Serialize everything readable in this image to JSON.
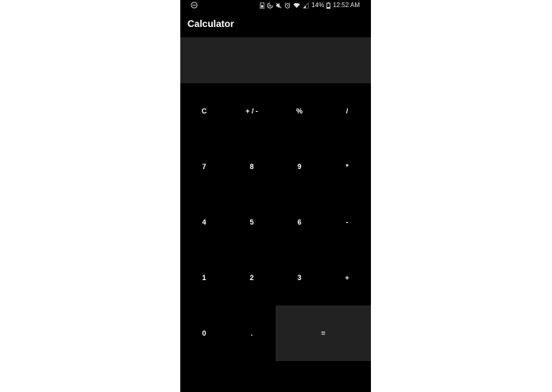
{
  "status_bar": {
    "battery": "14%",
    "time": "12:52 AM"
  },
  "app": {
    "title": "Calculator"
  },
  "display": {
    "value": ""
  },
  "keys": {
    "clear": "C",
    "sign": "+ / -",
    "percent": "%",
    "divide": "/",
    "seven": "7",
    "eight": "8",
    "nine": "9",
    "multiply": "*",
    "four": "4",
    "five": "5",
    "six": "6",
    "subtract": "-",
    "one": "1",
    "two": "2",
    "three": "3",
    "add": "+",
    "zero": "0",
    "decimal": ".",
    "equals": "="
  },
  "colors": {
    "background": "#000000",
    "display_bg": "#222222",
    "equals_bg": "#222222",
    "text": "#ffffff"
  },
  "icons": [
    "dnd-icon",
    "sim-icon",
    "data-saver-icon",
    "mute-icon",
    "alarm-icon",
    "wifi-icon",
    "signal-icon",
    "battery-icon"
  ]
}
